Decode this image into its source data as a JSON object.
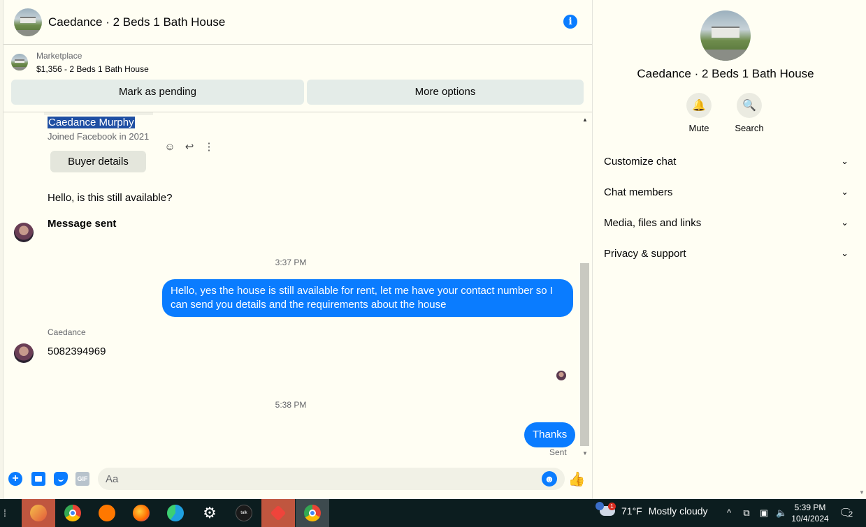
{
  "conversation": {
    "title": "Caedance · 2 Beds 1 Bath House",
    "info_icon": "info-icon"
  },
  "marketplace": {
    "kicker": "Marketplace",
    "item": "$1,356 - 2 Beds 1 Bath House",
    "mark_pending": "Mark as pending",
    "more_options": "More options"
  },
  "thread": {
    "buyer_name": "Caedance Murphy",
    "buyer_joined": "Joined Facebook in 2021",
    "buyer_details": "Buyer details",
    "msg_available": "Hello, is this still available?",
    "msg_sent": "Message sent",
    "timestamp_1": "3:37 PM",
    "outgoing_1": "Hello, yes the house is still available for rent, let me have your contact number so I can send you details and the requirements about the house",
    "sender_label": "Caedance",
    "incoming_phone": "5082394969",
    "timestamp_2": "5:38 PM",
    "outgoing_2": "Thanks",
    "status": "Sent"
  },
  "composer": {
    "placeholder": "Aa",
    "gif": "GIF"
  },
  "side_panel": {
    "title": "Caedance · 2 Beds 1 Bath House",
    "mute": "Mute",
    "search": "Search",
    "sections": [
      "Customize chat",
      "Chat members",
      "Media, files and links",
      "Privacy & support"
    ]
  },
  "taskbar": {
    "weather_badge": "1",
    "temperature": "71°F",
    "condition": "Mostly cloudy",
    "time": "5:39 PM",
    "date": "10/4/2024",
    "notification_count": "2",
    "talk_label": "talk"
  },
  "colors": {
    "accent": "#0a7cff",
    "background": "#fffef3",
    "taskbar": "#0c1d1f"
  }
}
